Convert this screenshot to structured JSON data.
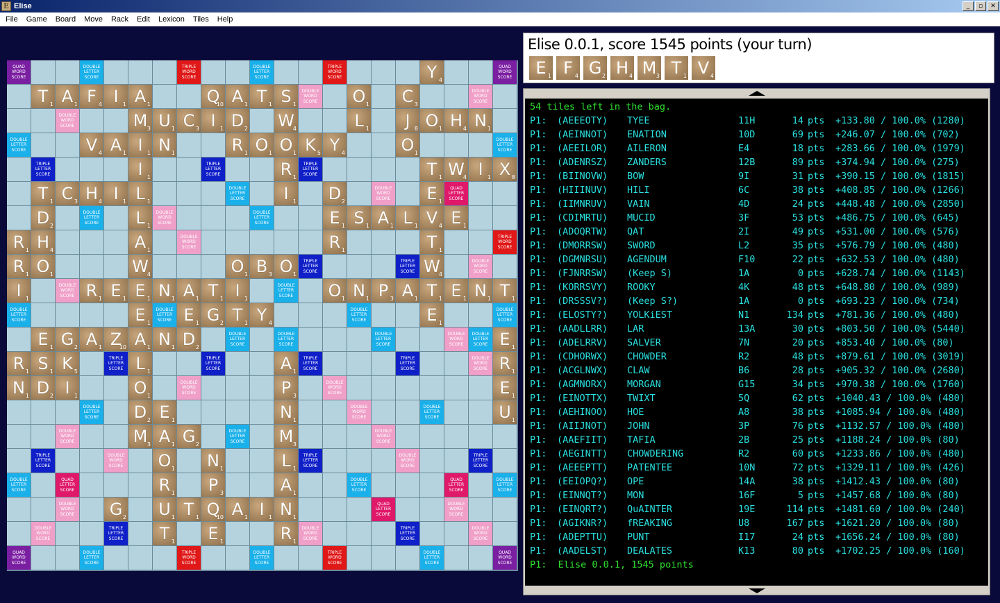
{
  "window": {
    "title": "Elise",
    "icon_letter": "E",
    "buttons": [
      "_",
      "▫",
      "✕"
    ]
  },
  "menu": [
    "File",
    "Game",
    "Board",
    "Move",
    "Rack",
    "Edit",
    "Lexicon",
    "Tiles",
    "Help"
  ],
  "premium_labels": {
    "QWS": "QUAD WORD SCORE",
    "TWS": "TRIPLE WORD SCORE",
    "DWS": "DOUBLE WORD SCORE",
    "DLS": "DOUBLE LETTER SCORE",
    "TLS": "TRIPLE LETTER SCORE",
    "QLS": "QUAD LETTER SCORE"
  },
  "premium_colors": {
    "QWS": "#7b1fa2",
    "TWS": "#e01818",
    "DWS": "#f0a0c8",
    "DLS": "#1ab0ea",
    "TLS": "#1020c8",
    "QLS": "#e0186a"
  },
  "board_rows": [
    "                 Y    ",
    " TAFIA  QATS  O C     ",
    "     MUCID W  L JOHN  ",
    "   VAIN  ROOKY  O     ",
    "     I     R     TWIXT",
    " CHILI     D E   D    ",
    " L   E       SALVER   ",
    "HA   R       T   R    ",
    "OW   O   BOW     I   R",
    "E  ENATION   PATENTEE ",
    "     G TYEE      G   A",
    " ZANDERS            K ",
    "LAR  N     D        I ",
    "OPE  D     E        N ",
    "     UM    A        G ",
    "     MON   L          ",
    "      R P  A          ",
    "      G U  T          ",
    "    Q AINTER          ",
    "      N T  S          ",
    "                      "
  ],
  "tiles": [
    {
      "l": "Y",
      "p": "4"
    },
    {
      "l": "T",
      "p": "1"
    },
    {
      "l": "A",
      "p": "1"
    },
    {
      "l": "F",
      "p": "4"
    },
    {
      "l": "I",
      "p": "1"
    },
    {
      "l": "A",
      "p": "1"
    },
    {
      "l": "Q",
      "p": "10"
    },
    {
      "l": "A",
      "p": "1"
    },
    {
      "l": "T",
      "p": "1"
    },
    {
      "l": "S",
      "p": "1"
    },
    {
      "l": "O",
      "p": "1"
    },
    {
      "l": "C",
      "p": "3"
    },
    {
      "l": "M",
      "p": "3"
    },
    {
      "l": "U",
      "p": "1"
    },
    {
      "l": "C",
      "p": "3"
    },
    {
      "l": "I",
      "p": "1"
    },
    {
      "l": "D",
      "p": "2"
    },
    {
      "l": "W",
      "p": "4"
    },
    {
      "l": "L",
      "p": "1"
    },
    {
      "l": "J",
      "p": "8"
    },
    {
      "l": "O",
      "p": "1"
    },
    {
      "l": "H",
      "p": "4"
    },
    {
      "l": "N",
      "p": "1"
    },
    {
      "l": "V",
      "p": "4"
    },
    {
      "l": "A",
      "p": "1"
    },
    {
      "l": "I",
      "p": "1"
    },
    {
      "l": "N",
      "p": "1"
    },
    {
      "l": "R",
      "p": "1"
    },
    {
      "l": "O",
      "p": "1"
    },
    {
      "l": "O",
      "p": "1"
    },
    {
      "l": "K",
      "p": "5"
    },
    {
      "l": "Y",
      "p": "4"
    },
    {
      "l": "O",
      "p": "1"
    },
    {
      "l": "I",
      "p": "1"
    },
    {
      "l": "R",
      "p": "1"
    },
    {
      "l": "T",
      "p": "1"
    },
    {
      "l": "W",
      "p": "4"
    },
    {
      "l": "I",
      "p": "1"
    },
    {
      "l": "X",
      "p": "8"
    },
    {
      "l": "T",
      "p": "1"
    },
    {
      "l": "C",
      "p": "3"
    },
    {
      "l": "H",
      "p": "4"
    },
    {
      "l": "I",
      "p": "1"
    },
    {
      "l": "L",
      "p": "1"
    },
    {
      "l": "I",
      "p": "1"
    },
    {
      "l": "D",
      "p": "2"
    },
    {
      "l": "E",
      "p": "1"
    },
    {
      "l": "D",
      "p": "2"
    },
    {
      "l": "L",
      "p": "1"
    },
    {
      "l": "E",
      "p": "1"
    },
    {
      "l": "S",
      "p": "1"
    },
    {
      "l": "A",
      "p": "1"
    },
    {
      "l": "L",
      "p": "1"
    },
    {
      "l": "V",
      "p": "4"
    },
    {
      "l": "E",
      "p": "1"
    },
    {
      "l": "R",
      "p": "1"
    },
    {
      "l": "H",
      "p": "4"
    },
    {
      "l": "A",
      "p": "1"
    },
    {
      "l": "R",
      "p": "1"
    },
    {
      "l": "T",
      "p": "1"
    },
    {
      "l": "R",
      "p": "1"
    },
    {
      "l": "O",
      "p": "1"
    },
    {
      "l": "W",
      "p": "4"
    },
    {
      "l": "O",
      "p": "1"
    },
    {
      "l": "B",
      "p": "3"
    },
    {
      "l": "O",
      "p": "1"
    },
    {
      "l": "W",
      "p": "4"
    },
    {
      "l": "I",
      "p": "1"
    },
    {
      "l": "R",
      "p": "1"
    },
    {
      "l": "E",
      "p": "1"
    },
    {
      "l": "E",
      "p": "1"
    },
    {
      "l": "N",
      "p": "1"
    },
    {
      "l": "A",
      "p": "1"
    },
    {
      "l": "T",
      "p": "1"
    },
    {
      "l": "I",
      "p": "1"
    },
    {
      "l": "O",
      "p": "1"
    },
    {
      "l": "N",
      "p": "1"
    },
    {
      "l": "P",
      "p": "3"
    },
    {
      "l": "A",
      "p": "1"
    },
    {
      "l": "T",
      "p": "1"
    },
    {
      "l": "E",
      "p": "1"
    },
    {
      "l": "N",
      "p": "1"
    },
    {
      "l": "T",
      "p": "1"
    },
    {
      "l": "E",
      "p": "1"
    },
    {
      "l": "E",
      "p": "1"
    },
    {
      "l": "G",
      "p": "2"
    },
    {
      "l": "T",
      "p": "1"
    },
    {
      "l": "Y",
      "p": "4"
    },
    {
      "l": "E",
      "p": "1"
    },
    {
      "l": "E",
      "p": "1"
    },
    {
      "l": "G",
      "p": "2"
    },
    {
      "l": "A",
      "p": "1"
    },
    {
      "l": "Z",
      "p": "10"
    },
    {
      "l": "A",
      "p": "1"
    },
    {
      "l": "N",
      "p": "1"
    },
    {
      "l": "D",
      "p": "2"
    },
    {
      "l": "E",
      "p": "1"
    },
    {
      "l": "R",
      "p": "1"
    },
    {
      "l": "S",
      "p": "1"
    },
    {
      "l": "K",
      "p": "5"
    },
    {
      "l": "L",
      "p": "1"
    },
    {
      "l": "A",
      "p": "1"
    },
    {
      "l": "R",
      "p": "1"
    },
    {
      "l": "N",
      "p": "1"
    },
    {
      "l": "D",
      "p": "2"
    },
    {
      "l": "I",
      "p": "1"
    },
    {
      "l": "O",
      "p": "1"
    },
    {
      "l": "P",
      "p": "3"
    },
    {
      "l": "E",
      "p": "1"
    },
    {
      "l": "D",
      "p": "2"
    },
    {
      "l": "E",
      "p": "1"
    },
    {
      "l": "N",
      "p": "1"
    },
    {
      "l": "U",
      "p": "1"
    },
    {
      "l": "M",
      "p": "3"
    },
    {
      "l": "A",
      "p": "1"
    },
    {
      "l": "G",
      "p": "2"
    },
    {
      "l": "M",
      "p": "3"
    },
    {
      "l": "O",
      "p": "1"
    },
    {
      "l": "N",
      "p": "1"
    },
    {
      "l": "L",
      "p": "1"
    },
    {
      "l": "R",
      "p": "1"
    },
    {
      "l": "P",
      "p": "3"
    },
    {
      "l": "A",
      "p": "1"
    },
    {
      "l": "G",
      "p": "2"
    },
    {
      "l": "U",
      "p": "1"
    },
    {
      "l": "T",
      "p": "1"
    },
    {
      "l": "Q",
      "p": "10"
    },
    {
      "l": "A",
      "p": "1"
    },
    {
      "l": "I",
      "p": "1"
    },
    {
      "l": "N",
      "p": "1"
    },
    {
      "l": "T",
      "p": "1"
    },
    {
      "l": "E",
      "p": "1"
    },
    {
      "l": "R",
      "p": "1"
    },
    {
      "l": "N",
      "p": "1"
    },
    {
      "l": "T",
      "p": "1"
    },
    {
      "l": "S",
      "p": "1"
    }
  ],
  "status": {
    "text": "Elise 0.0.1, score 1545 points (your turn)"
  },
  "rack": [
    {
      "l": "E",
      "p": "1"
    },
    {
      "l": "F",
      "p": "4"
    },
    {
      "l": "G",
      "p": "2"
    },
    {
      "l": "H",
      "p": "4"
    },
    {
      "l": "M",
      "p": "3"
    },
    {
      "l": "T",
      "p": "1"
    },
    {
      "l": "V",
      "p": "4"
    }
  ],
  "console": {
    "header": "54 tiles left in the bag.",
    "moves": [
      {
        "p": "P1:",
        "rack": "(AEEEOTY)",
        "word": "TYEE",
        "pos": "11H",
        "pts": "14",
        "lbl": "pts",
        "eq": "+133.80 / 100.0% (1280)"
      },
      {
        "p": "P1:",
        "rack": "(AEINNOT)",
        "word": "ENATION",
        "pos": "10D",
        "pts": "69",
        "lbl": "pts",
        "eq": "+246.07 / 100.0% (702)"
      },
      {
        "p": "P1:",
        "rack": "(AEEILOR)",
        "word": "AILERON",
        "pos": "E4",
        "pts": "18",
        "lbl": "pts",
        "eq": "+283.66 / 100.0% (1979)"
      },
      {
        "p": "P1:",
        "rack": "(ADENRSZ)",
        "word": "ZANDERS",
        "pos": "12B",
        "pts": "89",
        "lbl": "pts",
        "eq": "+374.94 / 100.0% (275)"
      },
      {
        "p": "P1:",
        "rack": "(BIINOVW)",
        "word": "BOW",
        "pos": "9I",
        "pts": "31",
        "lbl": "pts",
        "eq": "+390.15 / 100.0% (1815)"
      },
      {
        "p": "P1:",
        "rack": "(HIIINUV)",
        "word": "HILI",
        "pos": "6C",
        "pts": "38",
        "lbl": "pts",
        "eq": "+408.85 / 100.0% (1266)"
      },
      {
        "p": "P1:",
        "rack": "(IIMNRUV)",
        "word": "VAIN",
        "pos": "4D",
        "pts": "24",
        "lbl": "pts",
        "eq": "+448.48 / 100.0% (2850)"
      },
      {
        "p": "P1:",
        "rack": "(CDIMRTU)",
        "word": "MUCID",
        "pos": "3F",
        "pts": "53",
        "lbl": "pts",
        "eq": "+486.75 / 100.0% (645)"
      },
      {
        "p": "P1:",
        "rack": "(ADOQRTW)",
        "word": "QAT",
        "pos": "2I",
        "pts": "49",
        "lbl": "pts",
        "eq": "+531.00 / 100.0% (576)"
      },
      {
        "p": "P1:",
        "rack": "(DMORRSW)",
        "word": "SWORD",
        "pos": "L2",
        "pts": "35",
        "lbl": "pts",
        "eq": "+576.79 / 100.0% (480)"
      },
      {
        "p": "P1:",
        "rack": "(DGMNRSU)",
        "word": "AGENDUM",
        "pos": "F10",
        "pts": "22",
        "lbl": "pts",
        "eq": "+632.53 / 100.0% (480)"
      },
      {
        "p": "P1:",
        "rack": "(FJNRRSW)",
        "word": "(Keep S)",
        "pos": "1A",
        "pts": "0",
        "lbl": "pts",
        "eq": "+628.74 / 100.0% (1143)"
      },
      {
        "p": "P1:",
        "rack": "(KORRSVY)",
        "word": "ROOKY",
        "pos": "4K",
        "pts": "48",
        "lbl": "pts",
        "eq": "+648.80 / 100.0% (989)"
      },
      {
        "p": "P1:",
        "rack": "(DRSSSV?)",
        "word": "(Keep S?)",
        "pos": "1A",
        "pts": "0",
        "lbl": "pts",
        "eq": "+693.23 / 100.0% (734)"
      },
      {
        "p": "P1:",
        "rack": "(ELOSTY?)",
        "word": "YOLKiEST",
        "pos": "N1",
        "pts": "134",
        "lbl": "pts",
        "eq": "+781.36 / 100.0% (480)"
      },
      {
        "p": "P1:",
        "rack": "(AADLLRR)",
        "word": "LAR",
        "pos": "13A",
        "pts": "30",
        "lbl": "pts",
        "eq": "+803.50 / 100.0% (5440)"
      },
      {
        "p": "P1:",
        "rack": "(ADELRRV)",
        "word": "SALVER",
        "pos": "7N",
        "pts": "20",
        "lbl": "pts",
        "eq": "+853.40 / 100.0% (80)"
      },
      {
        "p": "P1:",
        "rack": "(CDHORWX)",
        "word": "CHOWDER",
        "pos": "R2",
        "pts": "48",
        "lbl": "pts",
        "eq": "+879.61 / 100.0% (3019)"
      },
      {
        "p": "P1:",
        "rack": "(ACGLNWX)",
        "word": "CLAW",
        "pos": "B6",
        "pts": "28",
        "lbl": "pts",
        "eq": "+905.32 / 100.0% (2680)"
      },
      {
        "p": "P1:",
        "rack": "(AGMNORX)",
        "word": "MORGAN",
        "pos": "G15",
        "pts": "34",
        "lbl": "pts",
        "eq": "+970.38 / 100.0% (1760)"
      },
      {
        "p": "P1:",
        "rack": "(EINOTTX)",
        "word": "TWIXT",
        "pos": "5Q",
        "pts": "62",
        "lbl": "pts",
        "eq": "+1040.43 / 100.0% (480)"
      },
      {
        "p": "P1:",
        "rack": "(AEHINOO)",
        "word": "HOE",
        "pos": "A8",
        "pts": "38",
        "lbl": "pts",
        "eq": "+1085.94 / 100.0% (480)"
      },
      {
        "p": "P1:",
        "rack": "(AIIJNOT)",
        "word": "JOHN",
        "pos": "3P",
        "pts": "76",
        "lbl": "pts",
        "eq": "+1132.57 / 100.0% (480)"
      },
      {
        "p": "P1:",
        "rack": "(AAEFIIT)",
        "word": "TAFIA",
        "pos": "2B",
        "pts": "25",
        "lbl": "pts",
        "eq": "+1188.24 / 100.0% (80)"
      },
      {
        "p": "P1:",
        "rack": "(AEGINTT)",
        "word": "CHOWDERING",
        "pos": "R2",
        "pts": "60",
        "lbl": "pts",
        "eq": "+1233.86 / 100.0% (480)"
      },
      {
        "p": "P1:",
        "rack": "(AEEEPTT)",
        "word": "PATENTEE",
        "pos": "10N",
        "pts": "72",
        "lbl": "pts",
        "eq": "+1329.11 / 100.0% (426)"
      },
      {
        "p": "P1:",
        "rack": "(EEIOPQ?)",
        "word": "OPE",
        "pos": "14A",
        "pts": "38",
        "lbl": "pts",
        "eq": "+1412.43 / 100.0% (80)"
      },
      {
        "p": "P1:",
        "rack": "(EINNQT?)",
        "word": "MON",
        "pos": "16F",
        "pts": "5",
        "lbl": "pts",
        "eq": "+1457.68 / 100.0% (80)"
      },
      {
        "p": "P1:",
        "rack": "(EINQRT?)",
        "word": "QuAINTER",
        "pos": "19E",
        "pts": "114",
        "lbl": "pts",
        "eq": "+1481.60 / 100.0% (240)"
      },
      {
        "p": "P1:",
        "rack": "(AGIKNR?)",
        "word": "fREAKING",
        "pos": "U8",
        "pts": "167",
        "lbl": "pts",
        "eq": "+1621.20 / 100.0% (80)"
      },
      {
        "p": "P1:",
        "rack": "(ADEPTTU)",
        "word": "PUNT",
        "pos": "I17",
        "pts": "24",
        "lbl": "pts",
        "eq": "+1656.24 / 100.0% (80)"
      },
      {
        "p": "P1:",
        "rack": "(AADELST)",
        "word": "DEALATES",
        "pos": "K13",
        "pts": "80",
        "lbl": "pts",
        "eq": "+1702.25 / 100.0% (160)"
      }
    ],
    "footer": "P1:  Elise 0.0.1, 1545 points"
  }
}
